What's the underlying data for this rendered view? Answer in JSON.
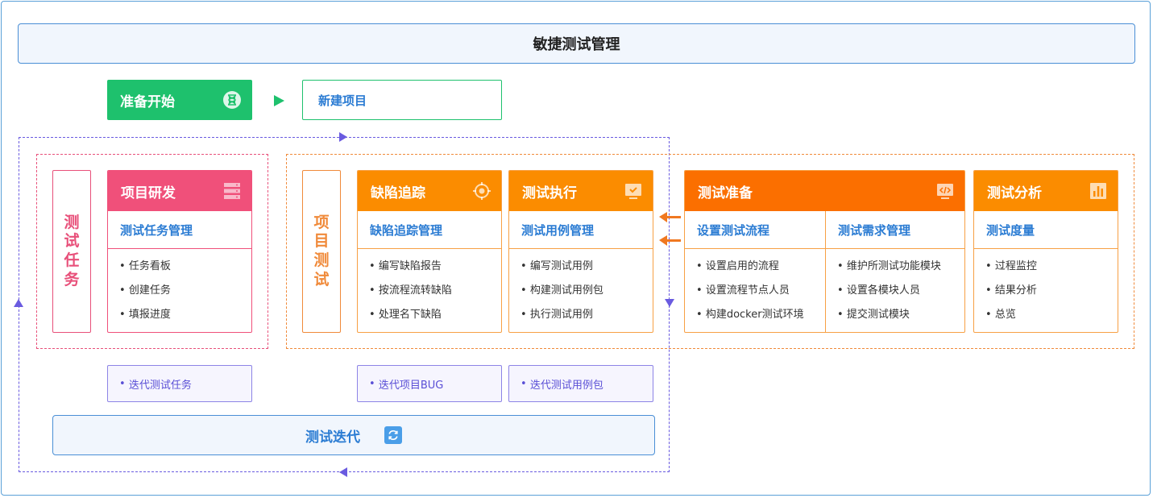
{
  "title": "敏捷测试管理",
  "start": {
    "label": "准备开始",
    "icon": "hourglass-icon"
  },
  "new_project": {
    "label": "新建项目"
  },
  "dev_group": {
    "vertical_label": [
      "测",
      "试",
      "任",
      "务"
    ],
    "card": {
      "title": "项目研发",
      "icon": "server-icon",
      "subtitle": "测试任务管理",
      "items": [
        "任务看板",
        "创建任务",
        "填报进度"
      ]
    },
    "iteration": "迭代测试任务"
  },
  "test_group": {
    "vertical_label": [
      "项",
      "目",
      "测",
      "试"
    ],
    "cards": [
      {
        "title": "缺陷追踪",
        "icon": "target-icon",
        "subtitle": "缺陷追踪管理",
        "items": [
          "编写缺陷报告",
          "按流程流转缺陷",
          "处理名下缺陷"
        ]
      },
      {
        "title": "测试执行",
        "icon": "monitor-check-icon",
        "subtitle": "测试用例管理",
        "items": [
          "编写测试用例",
          "构建测试用例包",
          "执行测试用例"
        ]
      }
    ],
    "prep": {
      "title": "测试准备",
      "icon": "code-icon",
      "columns": [
        {
          "subtitle": "设置测试流程",
          "items": [
            "设置启用的流程",
            "设置流程节点人员",
            "构建docker测试环境"
          ]
        },
        {
          "subtitle": "测试需求管理",
          "items": [
            "维护所测试功能模块",
            "设置各模块人员",
            "提交测试模块"
          ]
        }
      ]
    },
    "analysis": {
      "title": "测试分析",
      "icon": "bar-chart-icon",
      "subtitle": "测试度量",
      "items": [
        "过程监控",
        "结果分析",
        "总览"
      ]
    },
    "iterations": [
      "迭代项目BUG",
      "迭代测试用例包"
    ]
  },
  "iteration_bar": {
    "label": "测试迭代",
    "icon": "refresh-icon"
  },
  "colors": {
    "green": "#1ec16d",
    "red": "#f0507a",
    "orange": "#fb8c00",
    "deep_orange": "#fb6f00",
    "blue": "#2b7cd3",
    "purple": "#6a5be0"
  }
}
